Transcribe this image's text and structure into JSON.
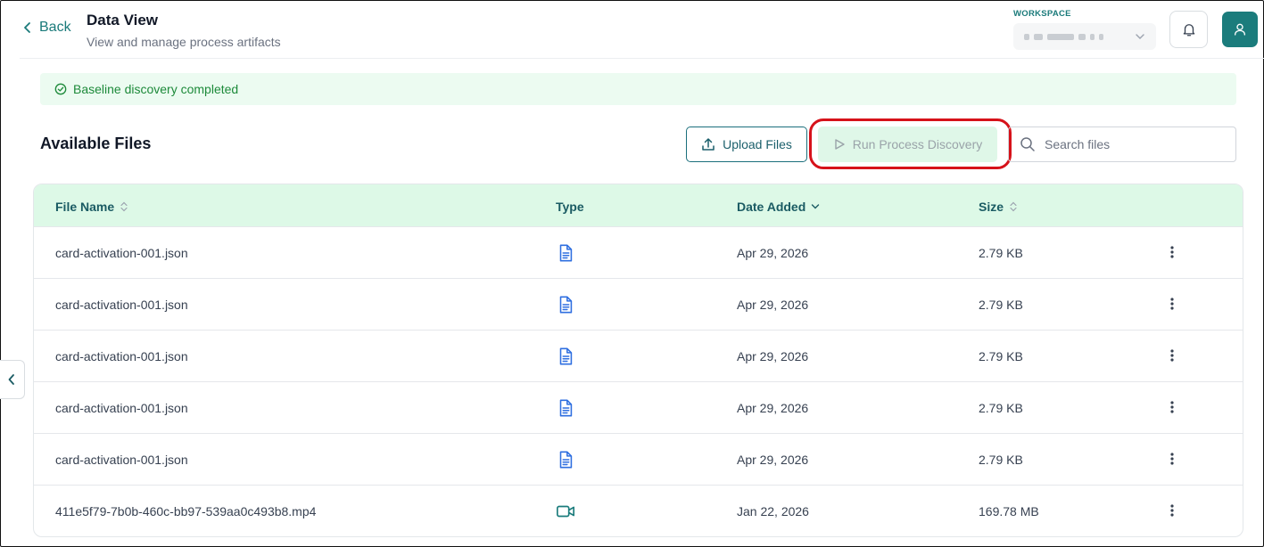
{
  "header": {
    "back_label": "Back",
    "title": "Data View",
    "subtitle": "View and manage process artifacts",
    "workspace_label": "WORKSPACE",
    "notification_icon": "bell-icon",
    "user_icon": "user-icon"
  },
  "banner": {
    "text": "Baseline discovery completed",
    "icon": "check-circle-icon",
    "color": "#1d8a3a"
  },
  "files": {
    "title": "Available Files",
    "upload_label": "Upload Files",
    "run_label": "Run Process Discovery",
    "search_placeholder": "Search files",
    "columns": {
      "name": "File Name",
      "type": "Type",
      "date": "Date Added",
      "size": "Size"
    },
    "rows": [
      {
        "name": "card-activation-001.json",
        "type": "document",
        "date": "Apr 29, 2026",
        "size": "2.79 KB"
      },
      {
        "name": "card-activation-001.json",
        "type": "document",
        "date": "Apr 29, 2026",
        "size": "2.79 KB"
      },
      {
        "name": "card-activation-001.json",
        "type": "document",
        "date": "Apr 29, 2026",
        "size": "2.79 KB"
      },
      {
        "name": "card-activation-001.json",
        "type": "document",
        "date": "Apr 29, 2026",
        "size": "2.79 KB"
      },
      {
        "name": "card-activation-001.json",
        "type": "document",
        "date": "Apr 29, 2026",
        "size": "2.79 KB"
      },
      {
        "name": "411e5f79-7b0b-460c-bb97-539aa0c493b8.mp4",
        "type": "video",
        "date": "Jan 22, 2026",
        "size": "169.78 MB"
      }
    ]
  },
  "colors": {
    "accent": "#1b7c7c",
    "header_bg": "#ddf9e7",
    "doc_icon": "#2f6fe0",
    "video_icon": "#1b7c7c",
    "highlight": "#d6121a"
  }
}
